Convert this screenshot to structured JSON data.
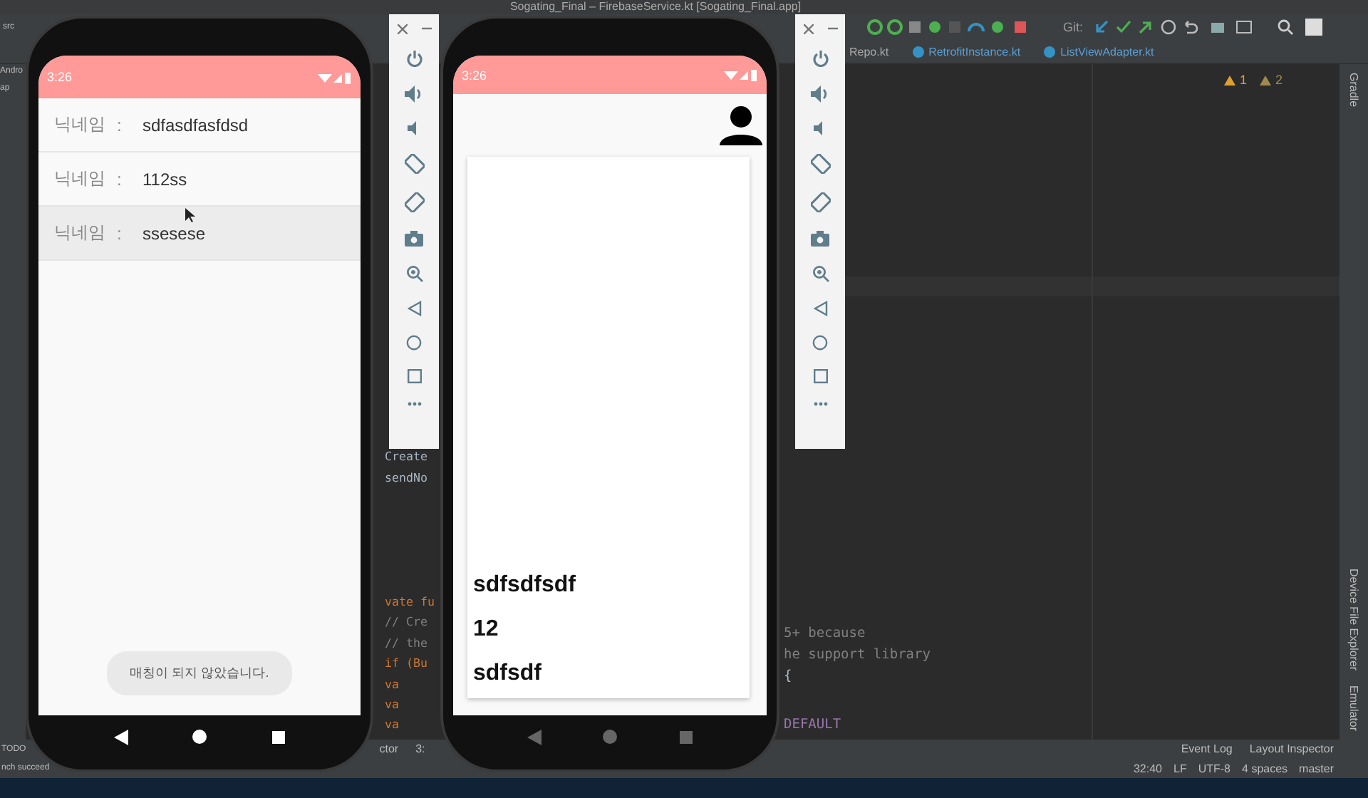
{
  "window": {
    "title": "Sogating_Final – FirebaseService.kt [Sogating_Final.app]"
  },
  "toolbar": {
    "breadcrumb": "src",
    "git_label": "Git:"
  },
  "project_panel": {
    "items": [
      "Andro",
      "ap"
    ]
  },
  "tabs": [
    {
      "label": "Repo.kt",
      "selected": false
    },
    {
      "label": "RetrofitInstance.kt",
      "selected": false
    },
    {
      "label": "ListViewAdapter.kt",
      "selected": false
    }
  ],
  "inspections": {
    "warnings": "1",
    "weak_warnings": "2"
  },
  "code_middle_top": [
    {
      "text": "Create",
      "kind": "plain"
    },
    {
      "text": "sendNo",
      "kind": "plain"
    }
  ],
  "code_middle_bottom": [
    {
      "text": "vate fu",
      "kind": "keyword"
    },
    {
      "text": "// Cre",
      "kind": "comment"
    },
    {
      "text": "// the",
      "kind": "comment"
    },
    {
      "text": "if (Bu",
      "kind": "keyword"
    },
    {
      "text": "va",
      "kind": "keyword"
    },
    {
      "text": "va",
      "kind": "keyword"
    },
    {
      "text": "va",
      "kind": "keyword"
    }
  ],
  "code_right_top": [
    {
      "text": "5+ because",
      "kind": "comment"
    },
    {
      "text": "he support library",
      "kind": "comment"
    },
    {
      "text": "{",
      "kind": "plain"
    }
  ],
  "code_right_bottom": [
    {
      "text": "DEFAULT",
      "kind": "constant"
    }
  ],
  "side_tools": {
    "top": "Gradle",
    "bottom": [
      "Device File Explorer",
      "Emulator"
    ]
  },
  "status_bar": {
    "todo": "TODO",
    "message": "nch succeed",
    "left": [
      "ctor",
      "3:"
    ],
    "tools": [
      "Event Log",
      "Layout Inspector"
    ],
    "position": "32:40",
    "line_ending": "LF",
    "encoding": "UTF-8",
    "indent": "4 spaces",
    "branch": "master"
  },
  "phone_left": {
    "time": "3:26",
    "rows": [
      {
        "label": "닉네임",
        "separator": ":",
        "value": "sdfasdfasfdsd",
        "selected": false
      },
      {
        "label": "닉네임",
        "separator": ":",
        "value": "112ss",
        "selected": false
      },
      {
        "label": "닉네임",
        "separator": ":",
        "value": "ssesese",
        "selected": true
      }
    ],
    "toast": "매칭이 되지 않았습니다."
  },
  "phone_right": {
    "time": "3:26",
    "card_lines": [
      "sdfsdfsdf",
      "12",
      "sdfsdf"
    ]
  }
}
